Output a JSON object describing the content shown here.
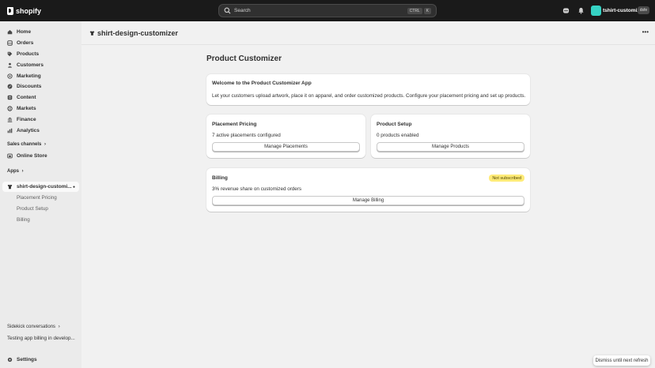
{
  "topbar": {
    "brand": "shopify",
    "search_placeholder": "Search",
    "shortcut_keys": [
      "CTRL",
      "K"
    ],
    "store_name": "tshirt-customizer",
    "store_initials": "dsfe",
    "accent": "#36d3c4"
  },
  "sidebar": {
    "items": [
      {
        "label": "Home",
        "icon": "home-icon"
      },
      {
        "label": "Orders",
        "icon": "orders-icon"
      },
      {
        "label": "Products",
        "icon": "tag-icon"
      },
      {
        "label": "Customers",
        "icon": "person-icon"
      },
      {
        "label": "Marketing",
        "icon": "target-icon"
      },
      {
        "label": "Discounts",
        "icon": "discount-icon"
      },
      {
        "label": "Content",
        "icon": "content-icon"
      },
      {
        "label": "Markets",
        "icon": "globe-icon"
      },
      {
        "label": "Finance",
        "icon": "bank-icon"
      },
      {
        "label": "Analytics",
        "icon": "chart-icon"
      }
    ],
    "sales_channels_label": "Sales channels",
    "online_store": "Online Store",
    "apps_label": "Apps",
    "app_name": "shirt-design-customi...",
    "app_sub_items": [
      "Placement Pricing",
      "Product Setup",
      "Billing"
    ],
    "sidekick_label": "Sidekick conversations",
    "sidekick_item": "Testing app billing in develop...",
    "settings": "Settings"
  },
  "main": {
    "app_title": "shirt-design-customizer",
    "page_title": "Product Customizer",
    "welcome": {
      "title": "Welcome to the Product Customizer App",
      "text": "Let your customers upload artwork, place it on apparel, and order customized products. Configure your placement pricing and set up products."
    },
    "placement": {
      "title": "Placement Pricing",
      "text": "7 active placements configured",
      "button": "Manage Placements"
    },
    "product_setup": {
      "title": "Product Setup",
      "text": "0 products enabled",
      "button": "Manage Products"
    },
    "billing": {
      "title": "Billing",
      "badge": "Not subscribed",
      "text": "3% revenue share on customized orders",
      "button": "Manage Billing"
    }
  },
  "toast": "Dismiss until next refresh"
}
